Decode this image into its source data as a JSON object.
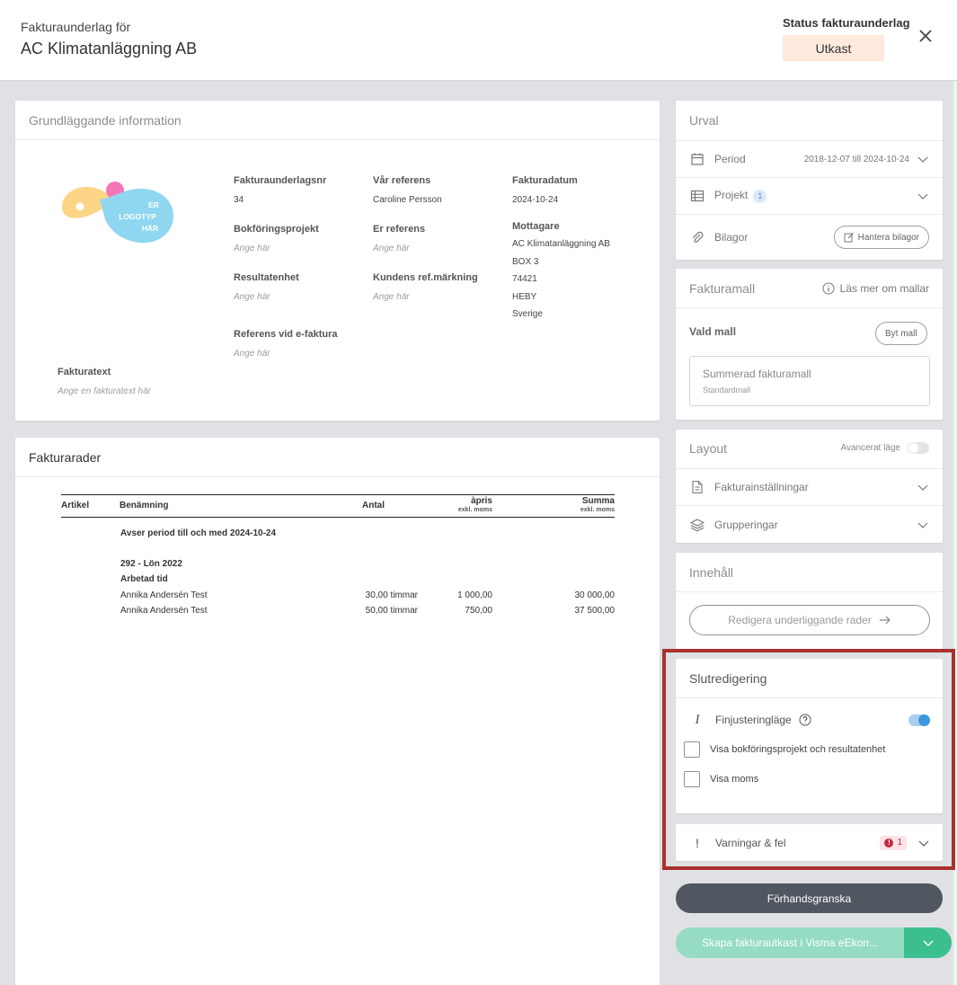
{
  "header": {
    "subtitle": "Fakturaunderlag för",
    "title": "AC Klimatanläggning AB",
    "status_label": "Status fakturaunderlag",
    "status_value": "Utkast"
  },
  "info": {
    "heading": "Grundläggande information",
    "logo_text": [
      "ER",
      "LOGOTYP",
      "HÄR"
    ],
    "fields": {
      "fakturaunderlagsnr": {
        "label": "Fakturaunderlagsnr",
        "value": "34"
      },
      "var_referens": {
        "label": "Vår referens",
        "value": "Caroline Persson"
      },
      "fakturadatum": {
        "label": "Fakturadatum",
        "value": "2024-10-24"
      },
      "bokforingsprojekt": {
        "label": "Bokföringsprojekt",
        "placeholder": "Ange här"
      },
      "er_referens": {
        "label": "Er referens",
        "placeholder": "Ange här"
      },
      "mottagare": {
        "label": "Mottagare",
        "lines": [
          "AC Klimatanläggning AB",
          "BOX 3",
          "74421",
          "HEBY",
          "Sverige"
        ]
      },
      "resultatenhet": {
        "label": "Resultatenhet",
        "placeholder": "Ange här"
      },
      "kundens_ref": {
        "label": "Kundens ref.märkning",
        "placeholder": "Ange här"
      },
      "referens_efaktura": {
        "label": "Referens vid e-faktura",
        "placeholder": "Ange här"
      },
      "fakturatext": {
        "label": "Fakturatext",
        "placeholder": "Ange en fakturatext här"
      }
    }
  },
  "rows": {
    "heading": "Fakturarader",
    "columns": {
      "artikel": "Artikel",
      "benamning": "Benämning",
      "antal": "Antal",
      "apris": "àpris",
      "apris_sub": "exkl. moms",
      "summa": "Summa",
      "summa_sub": "exkl. moms"
    },
    "period_text": "Avser period till och med 2024-10-24",
    "group_title": "292 - Lön 2022",
    "group_subtitle": "Arbetad tid",
    "lines": [
      {
        "name": "Annika Andersén Test",
        "antal": "30,00 timmar",
        "apris": "1 000,00",
        "summa": "30 000,00"
      },
      {
        "name": "Annika Andersén Test",
        "antal": "50,00 timmar",
        "apris": "750,00",
        "summa": "37 500,00"
      }
    ]
  },
  "urval": {
    "heading": "Urval",
    "period_label": "Period",
    "period_value": "2018-12-07 till 2024-10-24",
    "projekt_label": "Projekt",
    "projekt_count": "1",
    "bilagor_label": "Bilagor",
    "bilagor_button": "Hantera bilagor"
  },
  "fakturamall": {
    "heading": "Fakturamall",
    "info_link": "Läs mer om mallar",
    "vald_mall_label": "Vald mall",
    "byt_mall_button": "Byt mall",
    "mall_name": "Summerad fakturamall",
    "mall_type": "Standardmall"
  },
  "layout": {
    "heading": "Layout",
    "advanced_label": "Avancerat läge",
    "advanced_on": false,
    "installningar_label": "Fakturainställningar",
    "grupperingar_label": "Grupperingar"
  },
  "innehall": {
    "heading": "Innehåll",
    "edit_button": "Redigera underliggande rader"
  },
  "slutredigering": {
    "heading": "Slutredigering",
    "finjustering_label": "Finjusteringläge",
    "finjustering_on": true,
    "check1_label": "Visa bokföringsprojekt och resultatenhet",
    "check2_label": "Visa moms"
  },
  "varningar": {
    "label": "Varningar & fel",
    "count": "1"
  },
  "actions": {
    "preview": "Förhandsgranska",
    "create": "Skapa fakturautkast i Visma eEkon..."
  },
  "colors": {
    "status_badge_bg": "#fdeadd",
    "accent_blue": "#3a97e0",
    "create_green": "#95dcc3",
    "create_green_dark": "#3bbf8e",
    "preview_dark": "#515760",
    "error_red": "#c7283d",
    "highlight_frame": "#a8322e"
  }
}
